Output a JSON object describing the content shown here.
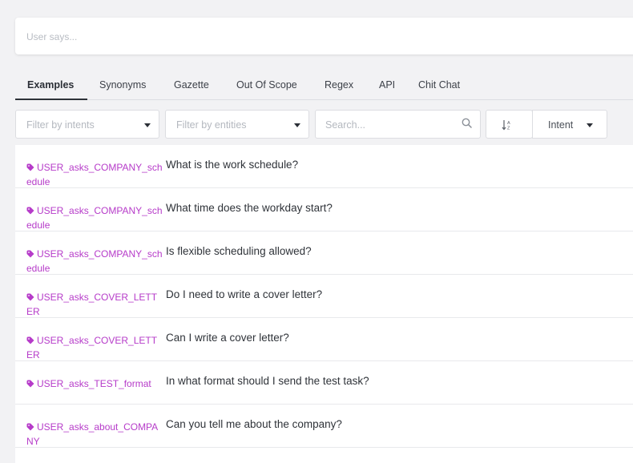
{
  "say_input": {
    "placeholder": "User says..."
  },
  "tabs": [
    "Examples",
    "Synonyms",
    "Gazette",
    "Out Of Scope",
    "Regex",
    "API",
    "Chit Chat"
  ],
  "filters": {
    "intents_placeholder": "Filter by intents",
    "entities_placeholder": "Filter by entities",
    "search_placeholder": "Search...",
    "sort_selected": "Intent"
  },
  "examples": [
    {
      "intent": "USER_asks_COMPANY_schedule",
      "text": "What is the work schedule?"
    },
    {
      "intent": "USER_asks_COMPANY_schedule",
      "text": "What time does the workday start?"
    },
    {
      "intent": "USER_asks_COMPANY_schedule",
      "text": "Is flexible scheduling allowed?"
    },
    {
      "intent": "USER_asks_COVER_LETTER",
      "text": "Do I need to write a cover letter?"
    },
    {
      "intent": "USER_asks_COVER_LETTER",
      "text": "Can I write a cover letter?"
    },
    {
      "intent": "USER_asks_TEST_format",
      "text": "In what format should I send the test task?"
    },
    {
      "intent": "USER_asks_about_COMPANY",
      "text": "Can you tell me about the company?"
    }
  ],
  "colors": {
    "intent_tag": "#b63bc9",
    "background": "#f2f2f4",
    "active_tab": "#2e3238"
  },
  "icons": {
    "intent": "tag-icon",
    "search": "search-icon",
    "sort": "sort-icon",
    "dropdown": "caret-down-icon"
  }
}
